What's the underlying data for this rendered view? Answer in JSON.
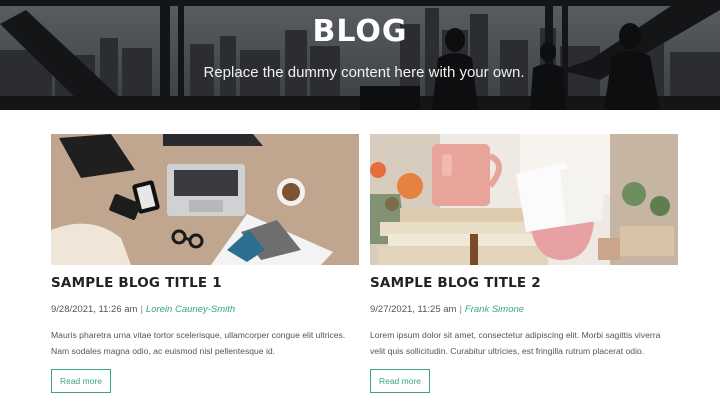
{
  "hero": {
    "title": "BLOG",
    "subtitle": "Replace the dummy content here with your own."
  },
  "posts": [
    {
      "title": "SAMPLE BLOG TITLE 1",
      "date": "9/28/2021, 11:26 am",
      "separator": "|",
      "author": "Lorein Cauney-Smith",
      "excerpt": "Mauris pharetra urna vitae tortor scelerisque, ullamcorper congue elit ultrices. Nam sodales magna odio, ac euismod nisl pellentesque id.",
      "read_more": "Read more",
      "image_icon": "laptop-desk-photo"
    },
    {
      "title": "SAMPLE BLOG TITLE 2",
      "date": "9/27/2021, 11:25 am",
      "separator": "|",
      "author": "Frank Simone",
      "excerpt": "Lorem ipsum dolor sit amet, consectetur adipiscing elit. Morbi sagittis viverra velit quis sollicitudin. Curabitur ultricies, est fringilla rutrum placerat odio.",
      "read_more": "Read more",
      "image_icon": "books-mug-photo"
    }
  ],
  "colors": {
    "accent": "#3aa57c",
    "hero_overlay": "#2a2c2f"
  }
}
